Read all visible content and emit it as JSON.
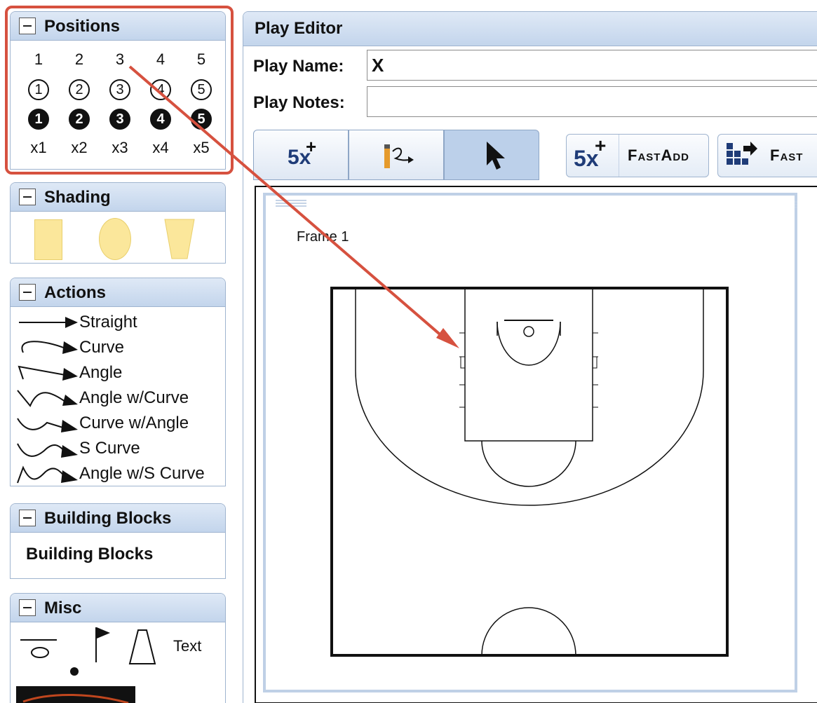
{
  "panels": {
    "positions": {
      "title": "Positions",
      "plain": [
        "1",
        "2",
        "3",
        "4",
        "5"
      ],
      "outlined": [
        "1",
        "2",
        "3",
        "4",
        "5"
      ],
      "filled": [
        "1",
        "2",
        "3",
        "4",
        "5"
      ],
      "defense": [
        "x1",
        "x2",
        "x3",
        "x4",
        "x5"
      ]
    },
    "shading": {
      "title": "Shading",
      "shapes": [
        "rectangle-shade",
        "ellipse-shade",
        "trapezoid-shade"
      ],
      "color": "#fbe79b"
    },
    "actions": {
      "title": "Actions",
      "items": [
        {
          "label": "Straight",
          "icon": "straight-arrow-icon"
        },
        {
          "label": "Curve",
          "icon": "curve-arrow-icon"
        },
        {
          "label": "Angle",
          "icon": "angle-arrow-icon"
        },
        {
          "label": "Angle w/Curve",
          "icon": "angle-curve-arrow-icon"
        },
        {
          "label": "Curve w/Angle",
          "icon": "curve-angle-arrow-icon"
        },
        {
          "label": "S Curve",
          "icon": "s-curve-arrow-icon"
        },
        {
          "label": "Angle w/S Curve",
          "icon": "angle-s-curve-arrow-icon"
        }
      ]
    },
    "building_blocks": {
      "title": "Building Blocks",
      "item": "Building Blocks"
    },
    "misc": {
      "title": "Misc",
      "text_tool": "Text",
      "icons": [
        "hoop-icon",
        "flag-icon",
        "cone-icon",
        "ball-icon"
      ]
    }
  },
  "editor": {
    "title": "Play Editor",
    "play_name_label": "Play Name:",
    "play_name_value": "X",
    "play_notes_label": "Play Notes:",
    "play_notes_value": "",
    "toolbar": {
      "add_players_badge": "5x",
      "fast_add_badge": "5x",
      "fast_add_label": "FastAdd",
      "fast_move_label": "Fast"
    },
    "frame_label": "Frame 1"
  },
  "colors": {
    "panel_header": "#c3d5ec",
    "panel_border": "#9fb4cf",
    "highlight": "#d6513f",
    "active_tool": "#bcd0ea"
  }
}
